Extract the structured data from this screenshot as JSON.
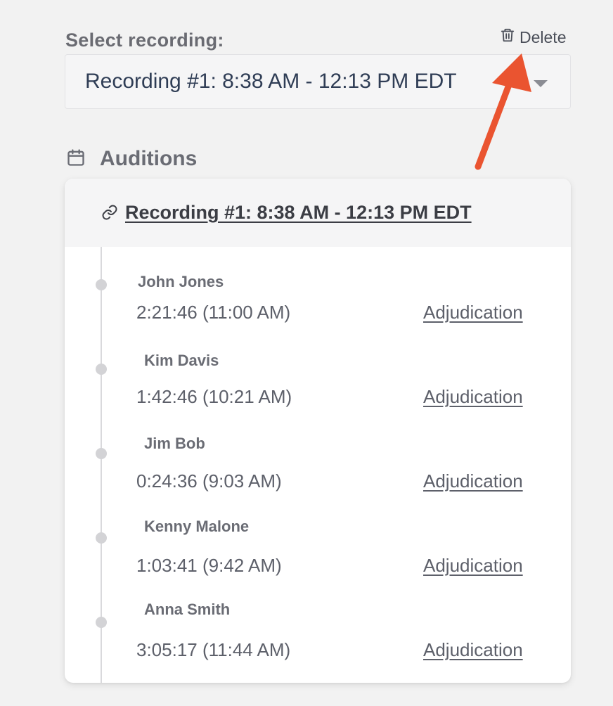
{
  "select": {
    "label": "Select recording:",
    "value": "Recording #1: 8:38 AM - 12:13 PM EDT"
  },
  "delete": {
    "label": "Delete",
    "icon": "trash-icon"
  },
  "annotation": {
    "arrow_color": "#ea5430"
  },
  "section": {
    "title": "Auditions",
    "icon": "calendar-icon"
  },
  "card": {
    "title": "Recording #1: 8:38 AM - 12:13 PM EDT",
    "icon": "link-icon",
    "entries": [
      {
        "name": "John Jones",
        "time": "2:21:46 (11:00 AM)",
        "link": "Adjudication"
      },
      {
        "name": "Kim Davis",
        "time": "1:42:46 (10:21 AM)",
        "link": "Adjudication"
      },
      {
        "name": "Jim Bob",
        "time": "0:24:36 (9:03 AM)",
        "link": "Adjudication"
      },
      {
        "name": "Kenny Malone",
        "time": "1:03:41 (9:42 AM)",
        "link": "Adjudication"
      },
      {
        "name": "Anna Smith",
        "time": "3:05:17 (11:44 AM)",
        "link": "Adjudication"
      }
    ]
  }
}
